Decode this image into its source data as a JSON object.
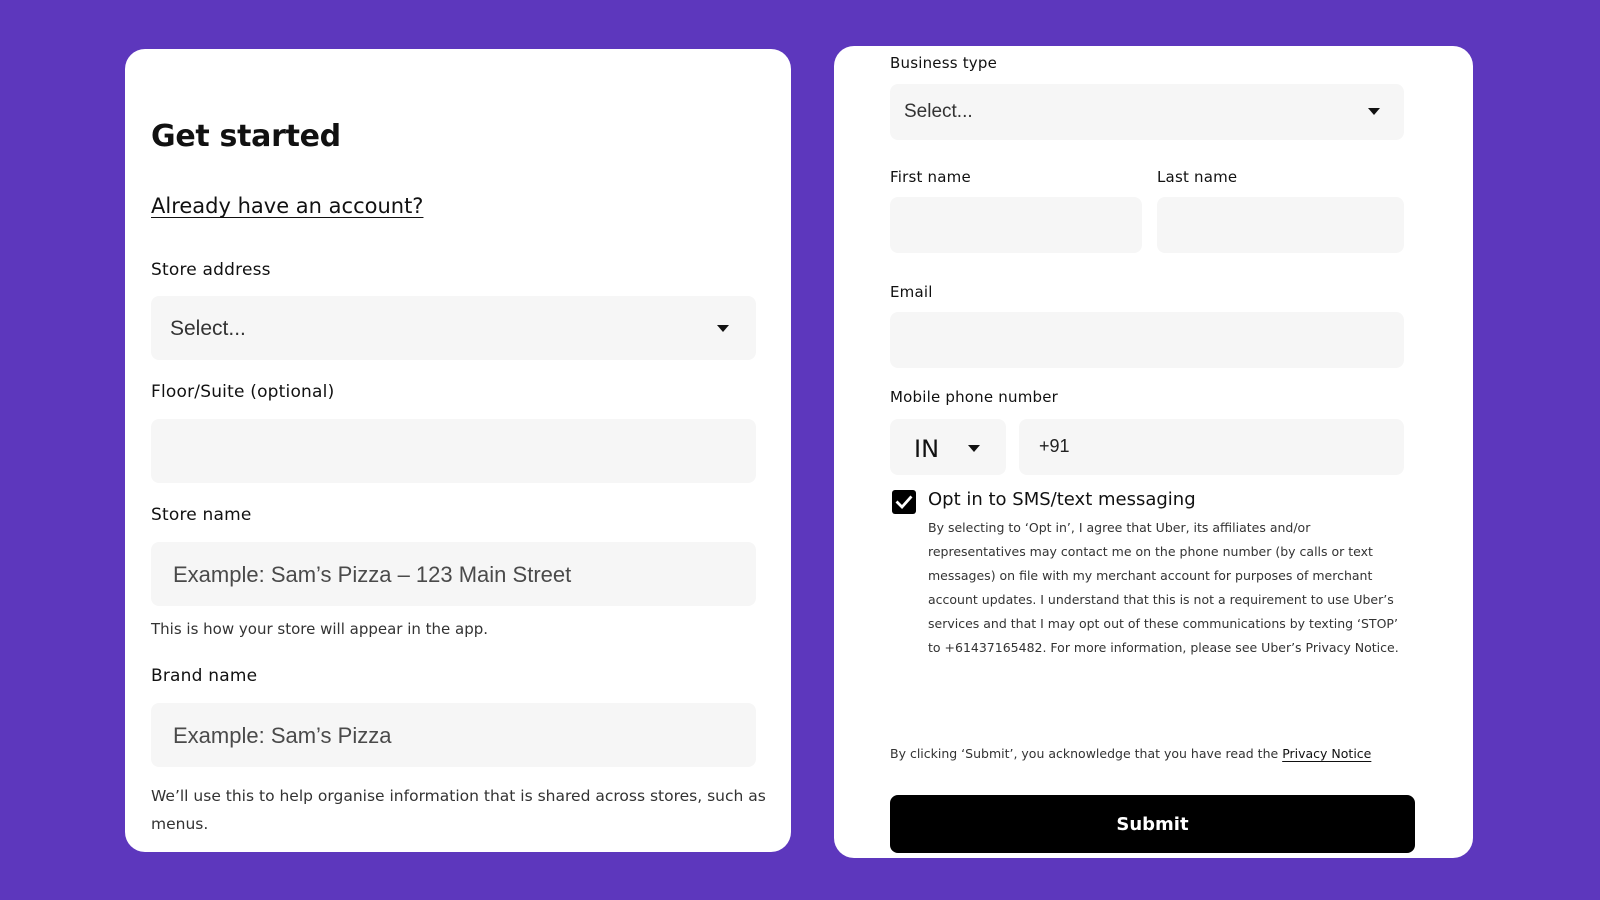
{
  "left_form": {
    "title": "Get started",
    "signin_link": "Already have an account?",
    "store_address": {
      "label": "Store address",
      "value": "Select..."
    },
    "floor_suite": {
      "label": "Floor/Suite (optional)",
      "value": ""
    },
    "store_name": {
      "label": "Store name",
      "placeholder": "Example: Sam’s Pizza – 123 Main Street",
      "hint": "This is how your store will appear in the app."
    },
    "brand_name": {
      "label": "Brand name",
      "placeholder": "Example: Sam’s Pizza",
      "hint": "We’ll use this to help organise information that is shared across stores, such as menus."
    }
  },
  "right_form": {
    "business_type": {
      "label": "Business type",
      "value": "Select..."
    },
    "first_name": {
      "label": "First name",
      "value": ""
    },
    "last_name": {
      "label": "Last name",
      "value": ""
    },
    "email": {
      "label": "Email",
      "value": ""
    },
    "phone": {
      "label": "Mobile phone number",
      "country": "IN",
      "prefix": "+91"
    },
    "sms_opt_in": {
      "checked": true,
      "label": "Opt in to SMS/text messaging",
      "disclaimer": "By selecting to ‘Opt in’, I agree that Uber, its affiliates and/or representatives may contact me on the phone number (by calls or text messages) on file with my merchant account for purposes of merchant account updates. I understand that this is not a requirement to use Uber’s services and that I may opt out of these communications by texting ‘STOP’ to +61437165482. For more information, please see Uber’s Privacy Notice."
    },
    "acknowledge": {
      "text": "By clicking ‘Submit’, you acknowledge that you have read the",
      "link": "Privacy Notice"
    },
    "submit_label": "Submit"
  },
  "colors": {
    "background": "#5d37bd",
    "card": "#ffffff",
    "input_fill": "#f6f6f6",
    "button": "#000000"
  },
  "icons": [
    "chevron-down-icon",
    "checkmark-icon"
  ]
}
